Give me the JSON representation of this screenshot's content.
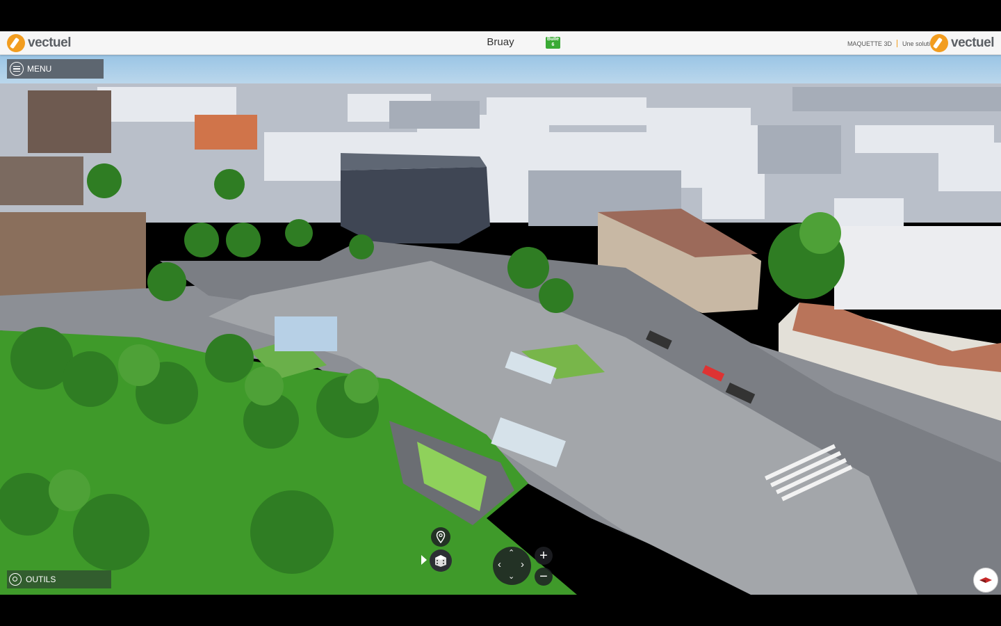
{
  "header": {
    "title": "Bruay",
    "badge": "Bulle\n6",
    "logo_left_word": "vectuel",
    "brand_label": "MAQUETTE 3D",
    "brand_tagline": "Une solution",
    "logo_right_word": "vectuel"
  },
  "menu": {
    "label": "MENU"
  },
  "tools": {
    "label": "OUTILS"
  },
  "controls": {
    "zoom_in": "+",
    "zoom_out": "−",
    "nav_up": "⌃",
    "nav_down": "⌄",
    "nav_left": "‹",
    "nav_right": "›"
  },
  "colors": {
    "accent": "#f29d1f",
    "header_bg": "#f6f6f6",
    "menu_bg": "#5d6670",
    "badge_green": "#3aaa35"
  }
}
